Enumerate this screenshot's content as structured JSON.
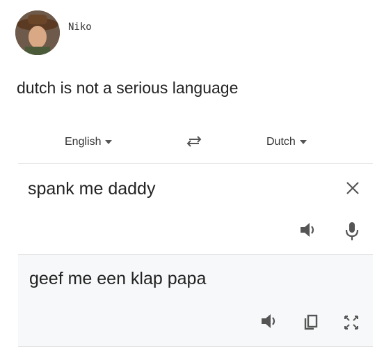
{
  "post": {
    "username": "Niko",
    "text": "dutch is not a serious language"
  },
  "translate": {
    "source_language": "English",
    "target_language": "Dutch",
    "source_text": "spank me daddy",
    "translated_text": "geef me een klap papa"
  },
  "icons": {
    "swap": "swap-arrows-icon",
    "clear": "close-icon",
    "speaker": "speaker-icon",
    "mic": "microphone-icon",
    "copy": "copy-icon",
    "fullscreen": "fullscreen-icon"
  }
}
